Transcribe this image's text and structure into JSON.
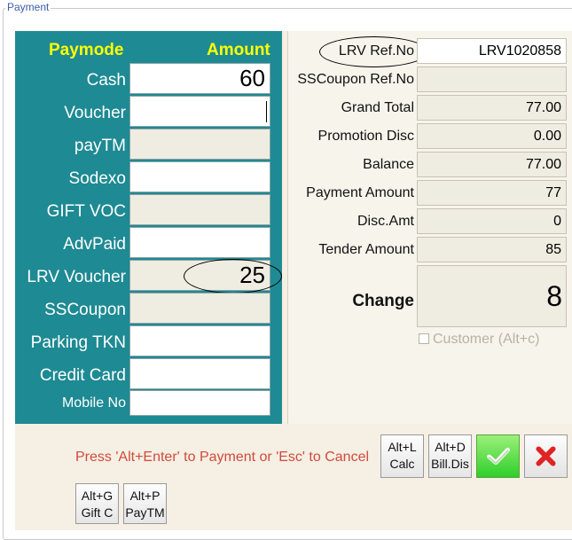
{
  "group_title": "Payment",
  "paymodes": {
    "header_paymode": "Paymode",
    "header_amount": "Amount",
    "rows": [
      {
        "label": "Cash",
        "value": "60",
        "enabled": true
      },
      {
        "label": "Voucher",
        "value": "",
        "enabled": true,
        "focused": true
      },
      {
        "label": "payTM",
        "value": "",
        "enabled": false
      },
      {
        "label": "Sodexo",
        "value": "",
        "enabled": true
      },
      {
        "label": "GIFT VOC",
        "value": "",
        "enabled": false
      },
      {
        "label": "AdvPaid",
        "value": "",
        "enabled": true
      },
      {
        "label": "LRV Voucher",
        "value": "25",
        "enabled": false
      },
      {
        "label": "SSCoupon",
        "value": "",
        "enabled": false
      },
      {
        "label": "Parking TKN",
        "value": "",
        "enabled": true
      },
      {
        "label": "Credit Card",
        "value": "",
        "enabled": true
      },
      {
        "label": "Mobile No",
        "value": "",
        "enabled": true
      }
    ]
  },
  "summary": {
    "lrv_ref_label": "LRV Ref.No",
    "lrv_ref_value": "LRV1020858",
    "sscoupon_ref_label": "SSCoupon Ref.No",
    "sscoupon_ref_value": "",
    "grand_total_label": "Grand Total",
    "grand_total_value": "77.00",
    "promotion_disc_label": "Promotion Disc",
    "promotion_disc_value": "0.00",
    "balance_label": "Balance",
    "balance_value": "77.00",
    "payment_amount_label": "Payment Amount",
    "payment_amount_value": "77",
    "disc_amt_label": "Disc.Amt",
    "disc_amt_value": "0",
    "tender_amount_label": "Tender Amount",
    "tender_amount_value": "85",
    "change_label": "Change",
    "change_value": "8",
    "customer_label": "Customer (Alt+c)"
  },
  "footer": {
    "hint": "Press 'Alt+Enter' to Payment or 'Esc' to Cancel",
    "calc_line1": "Alt+L",
    "calc_line2": "Calc",
    "billdis_line1": "Alt+D",
    "billdis_line2": "Bill.Dis",
    "giftc_line1": "Alt+G",
    "giftc_line2": "Gift C",
    "paytm_line1": "Alt+P",
    "paytm_line2": "PayTM",
    "ok_icon": "checkmark-icon",
    "cancel_icon": "close-icon",
    "colors": {
      "ok": "#2fcf2a",
      "cancel": "#e02424",
      "hint": "#d14b3c",
      "panel": "#1e8a93",
      "header": "#ffff00"
    }
  }
}
